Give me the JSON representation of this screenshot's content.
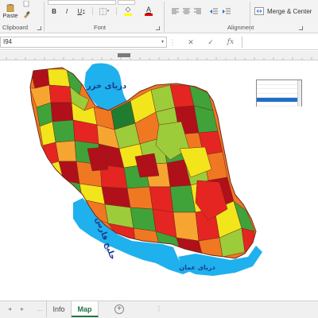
{
  "ribbon": {
    "clipboard": {
      "paste_label": "Paste",
      "group_label": "Clipboard"
    },
    "font": {
      "group_label": "Font",
      "bold": "B",
      "italic": "I",
      "underline": "U",
      "font_color_glyph": "A",
      "colors": {
        "highlight": "#ffff00",
        "font": "#e00000"
      }
    },
    "alignment": {
      "group_label": "Alignment",
      "merge_center_label": "Merge & Center"
    }
  },
  "formula_bar": {
    "name_box": "I94",
    "cancel_glyph": "✕",
    "enter_glyph": "✓",
    "function_glyph": "fx",
    "formula": ""
  },
  "map": {
    "labels": {
      "caspian": "دریای خزر",
      "persian_gulf": "خلیج فارس",
      "oman_sea": "دریای عمان"
    },
    "colors": {
      "water": "#1fb0ee",
      "dark_red": "#b0101a",
      "red": "#e52521",
      "orange": "#f07822",
      "light_orange": "#f6a531",
      "yellow": "#f2e51c",
      "light_green": "#9dcc3a",
      "green": "#3fa33a",
      "dark_green": "#1e7d2e",
      "border": "#6d2b1b"
    }
  },
  "listbox": {
    "item_count": 6,
    "selected_index": 4
  },
  "tabs": {
    "items": [
      {
        "label": "Info",
        "active": false
      },
      {
        "label": "Map",
        "active": true
      }
    ],
    "add_glyph": "+"
  }
}
